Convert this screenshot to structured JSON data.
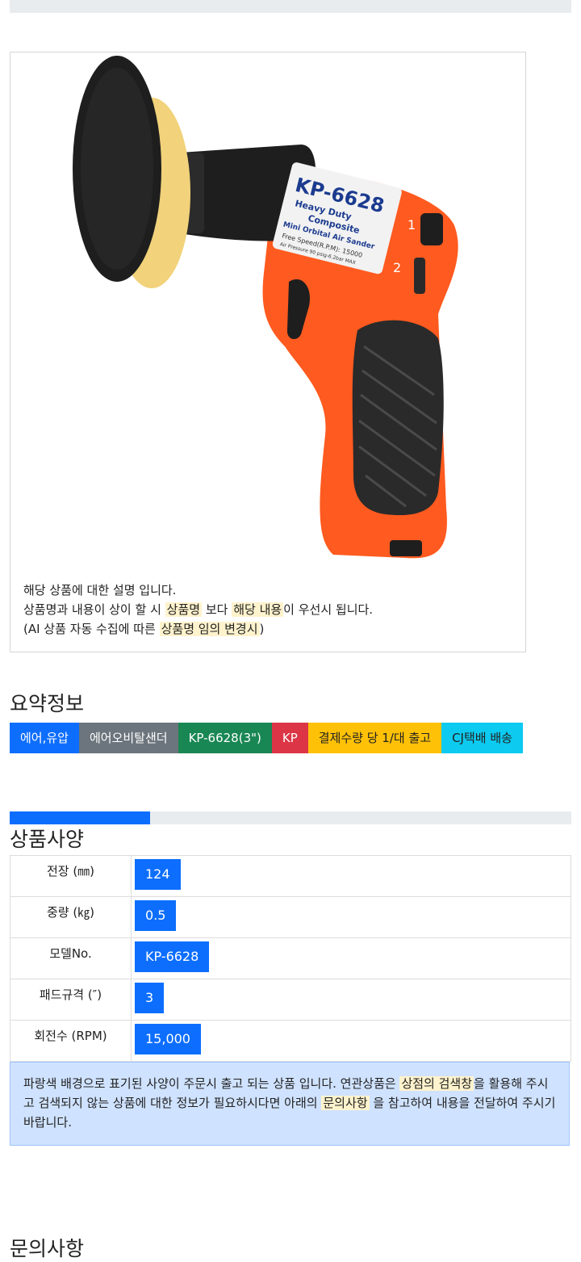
{
  "product": {
    "image_label": {
      "model": "KP-6628",
      "line1": "Heavy Duty",
      "line2": "Composite",
      "line3": "Mini Orbital Air Sander",
      "line4": "Free Speed(R.P.M): 15000",
      "line5": "Air Pressure 90 psig-6.2bar MAX",
      "mark1": "1",
      "mark2": "2"
    },
    "desc": {
      "line1": "해당 상품에 대한 설명 입니다.",
      "line2_a": "상품명과 내용이 상이 할 시 ",
      "line2_hl1": "상품명",
      "line2_b": " 보다 ",
      "line2_hl2": "해당 내용",
      "line2_c": "이 우선시 됩니다.",
      "line3_a": "(AI 상품 자동 수집에 따른 ",
      "line3_hl": "상품명 임의 변경시",
      "line3_b": ")"
    }
  },
  "summary": {
    "title": "요약정보",
    "badges": [
      {
        "label": "에어,유압",
        "bg": "#0d6efd",
        "fg": "#ffffff"
      },
      {
        "label": "에어오비탈샌더",
        "bg": "#6c757d",
        "fg": "#ffffff"
      },
      {
        "label": "KP-6628(3\")",
        "bg": "#198754",
        "fg": "#ffffff"
      },
      {
        "label": "KP",
        "bg": "#dc3545",
        "fg": "#ffffff"
      },
      {
        "label": "결제수량 당 1/대 출고",
        "bg": "#ffc107",
        "fg": "#222222"
      },
      {
        "label": "CJ택배 배송",
        "bg": "#0dcaf0",
        "fg": "#222222"
      }
    ]
  },
  "specs": {
    "progress_fraction": 0.25,
    "title": "상품사양",
    "rows": [
      {
        "name": "전장 (㎜)",
        "value": "124"
      },
      {
        "name": "중량 (㎏)",
        "value": "0.5"
      },
      {
        "name": "모델No.",
        "value": "KP-6628"
      },
      {
        "name": "패드규격 (″)",
        "value": "3"
      },
      {
        "name": "회전수 (RPM)",
        "value": "15,000"
      }
    ],
    "notice": {
      "a": "파랑색 배경으로 표기된 사양이 주문시 출고 되는 상품 입니다. 연관상품은 ",
      "hl1": "상점의 검색창",
      "b": "을 활용해 주시고 검색되지 않는 상품에 대한 정보가 필요하시다면 아래의 ",
      "hl2": "문의사항",
      "c": " 을 참고하여 내용을 전달하여 주시기 바랍니다."
    }
  },
  "inquiry": {
    "title": "문의사항"
  },
  "colors": {
    "accent": "#0d6efd",
    "tool_orange": "#ff5a1f",
    "tool_black": "#1e1e1e",
    "pad_yellow": "#f2d27a"
  }
}
